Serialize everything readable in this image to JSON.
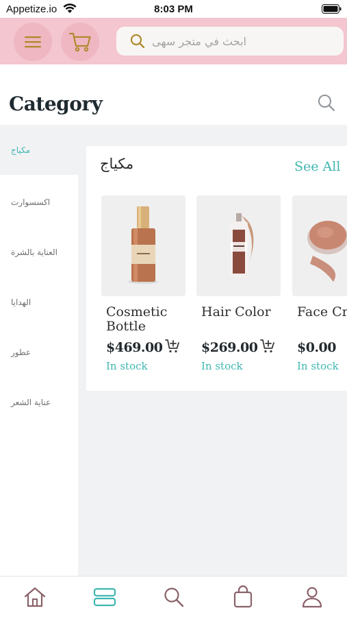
{
  "status_bar": {
    "carrier": "Appetize.io",
    "time": "8:03 PM"
  },
  "header": {
    "search": {
      "placeholder": "ابحث في متجر سهى"
    }
  },
  "page": {
    "title": "Category"
  },
  "sidebar": {
    "items": [
      {
        "label": "مكياج",
        "active": true
      },
      {
        "label": "اكسسوارت",
        "active": false
      },
      {
        "label": "العناية بالشرة",
        "active": false
      },
      {
        "label": "الهدايا",
        "active": false
      },
      {
        "label": "عطور",
        "active": false
      },
      {
        "label": "عناية الشعر",
        "active": false
      }
    ]
  },
  "panel": {
    "heading": "مكياج",
    "see_all": "See All",
    "products": [
      {
        "name": "Cosmetic\nBottle",
        "price": "$469.00",
        "stock": "In stock"
      },
      {
        "name": "Hair Color",
        "price": "$269.00",
        "stock": "In stock"
      },
      {
        "name": "Face Cre",
        "price": "$0.00",
        "stock": "In stock"
      }
    ]
  },
  "bottom_nav": {
    "items": [
      "home",
      "categories",
      "search",
      "bag",
      "profile"
    ],
    "active": "categories"
  },
  "colors": {
    "header_pink": "#f4c6cf",
    "button_pink": "#eeb7c2",
    "accent_teal": "#3fb6b0",
    "icon_brown": "#8a6168",
    "icon_gold": "#b08a2e"
  }
}
